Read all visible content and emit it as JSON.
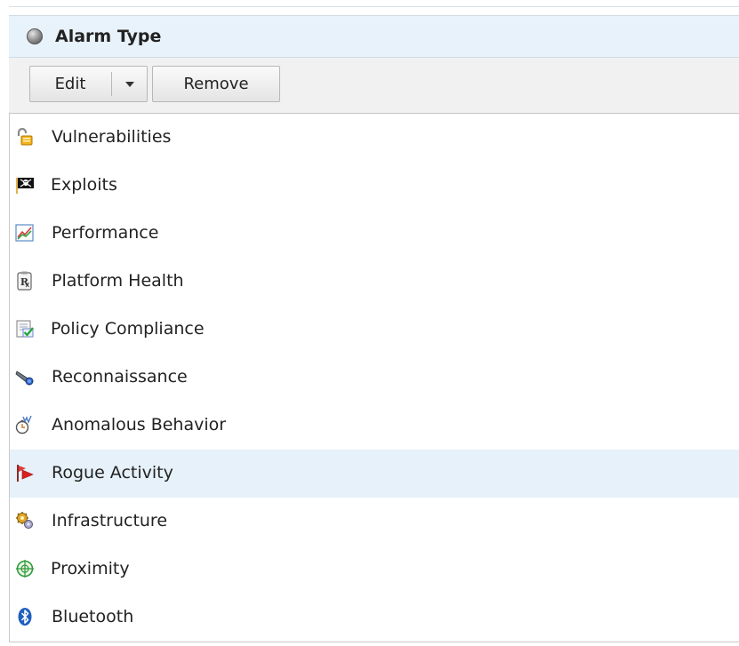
{
  "header": {
    "title": "Alarm Type"
  },
  "toolbar": {
    "edit_label": "Edit",
    "remove_label": "Remove"
  },
  "list": {
    "items": [
      {
        "label": "Vulnerabilities",
        "icon": "padlock-open-icon",
        "selected": false
      },
      {
        "label": "Exploits",
        "icon": "pirate-flag-icon",
        "selected": false
      },
      {
        "label": "Performance",
        "icon": "line-chart-icon",
        "selected": false
      },
      {
        "label": "Platform Health",
        "icon": "prescription-icon",
        "selected": false
      },
      {
        "label": "Policy Compliance",
        "icon": "checked-document-icon",
        "selected": false
      },
      {
        "label": "Reconnaissance",
        "icon": "telescope-icon",
        "selected": false
      },
      {
        "label": "Anomalous Behavior",
        "icon": "stopwatch-graph-icon",
        "selected": false
      },
      {
        "label": "Rogue Activity",
        "icon": "red-flag-icon",
        "selected": true
      },
      {
        "label": "Infrastructure",
        "icon": "gears-icon",
        "selected": false
      },
      {
        "label": "Proximity",
        "icon": "crosshair-icon",
        "selected": false
      },
      {
        "label": "Bluetooth",
        "icon": "bluetooth-icon",
        "selected": false
      }
    ]
  },
  "colors": {
    "header_bg": "#e8f2fb",
    "selected_row_bg": "#e6f1f9",
    "toolbar_bg": "#f1f1f1"
  }
}
